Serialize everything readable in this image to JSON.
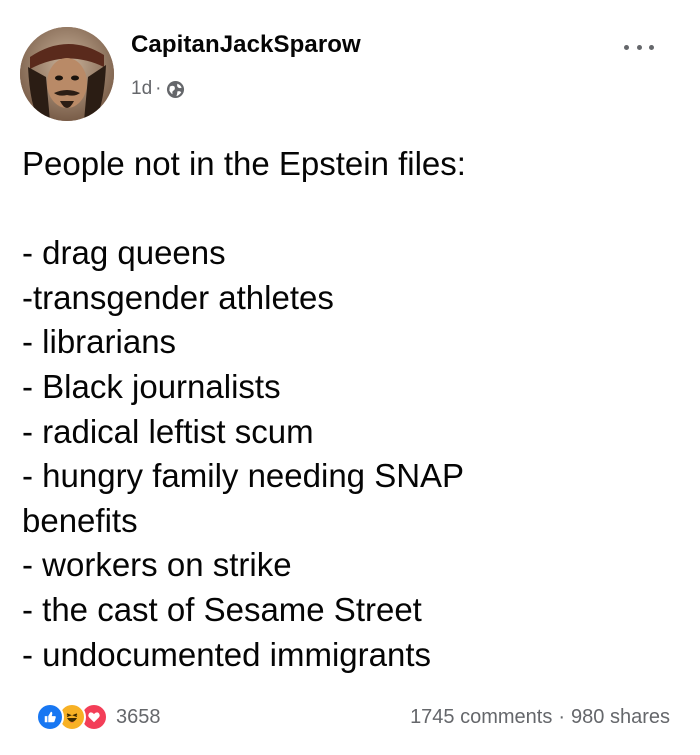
{
  "post": {
    "author": "CapitanJackSparow",
    "time": "1d",
    "meta_separator": "·",
    "privacy_icon": "globe-icon",
    "more_icon": "more-options-icon",
    "lines": [
      "People not in the Epstein files:",
      "",
      "- drag queens",
      "-transgender athletes",
      "- librarians",
      "- Black journalists",
      "- radical leftist scum",
      "- hungry family needing SNAP",
      "benefits",
      "- workers on strike",
      "- the cast of Sesame Street",
      "- undocumented immigrants"
    ]
  },
  "footer": {
    "reaction_icons": [
      "like-icon",
      "haha-icon",
      "love-icon"
    ],
    "reaction_count": "3658",
    "comments": "1745 comments",
    "separator": "·",
    "shares": "980 shares"
  },
  "colors": {
    "text": "#050505",
    "secondary": "#65676b",
    "like": "#1877f2",
    "haha": "#f7b125",
    "love": "#f33e58"
  }
}
